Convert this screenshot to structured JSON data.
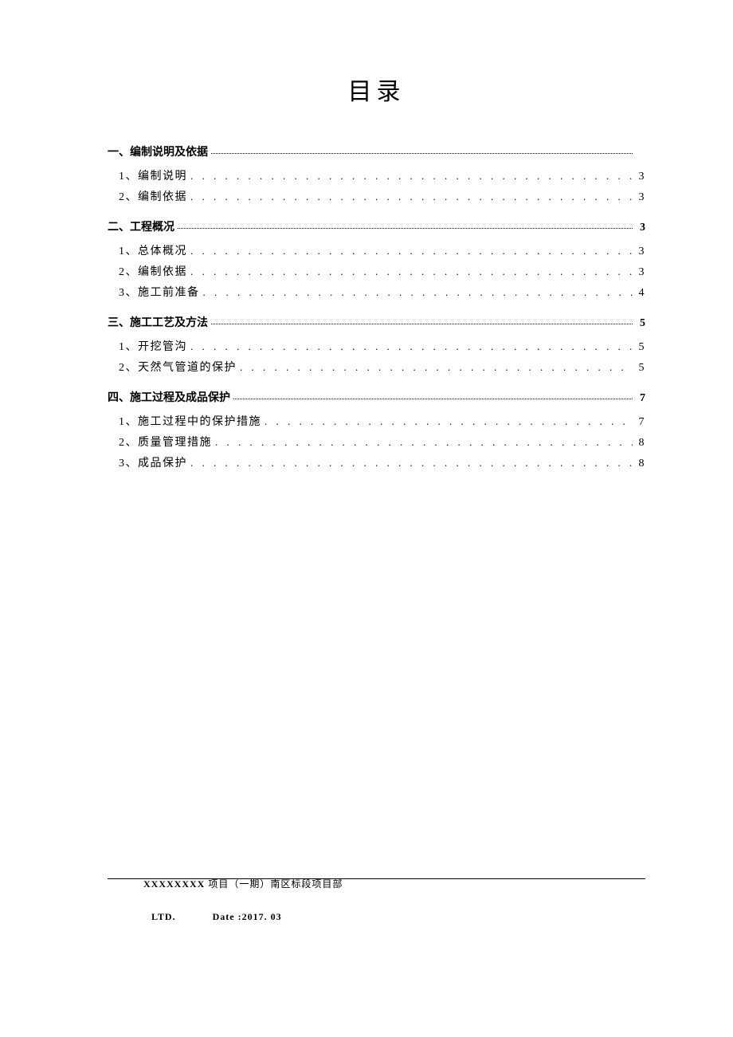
{
  "title": "目录",
  "sections": [
    {
      "num": "一、",
      "label": "编制说明及依据",
      "page": "",
      "subs": [
        {
          "num": "1、",
          "label": "编制说明",
          "page": "3"
        },
        {
          "num": "2、",
          "label": "编制依据",
          "page": "3"
        }
      ]
    },
    {
      "num": "二、",
      "label": "工程概况",
      "page": "3",
      "subs": [
        {
          "num": "1、",
          "label": "总体概况",
          "page": "3"
        },
        {
          "num": "2、",
          "label": "编制依据",
          "page": "3"
        },
        {
          "num": "3、",
          "label": "施工前准备",
          "page": "4"
        }
      ]
    },
    {
      "num": "三、",
      "label": "施工工艺及方法",
      "page": "5",
      "subs": [
        {
          "num": "1、",
          "label": "开挖管沟",
          "page": "5"
        },
        {
          "num": "2、",
          "label": "天然气管道的保护",
          "page": "5"
        }
      ]
    },
    {
      "num": "四、",
      "label": "施工过程及成品保护",
      "page": "7",
      "subs": [
        {
          "num": "1、",
          "label": "施工过程中的保护措施",
          "page": "7"
        },
        {
          "num": "2、",
          "label": "质量管理措施",
          "page": "8"
        },
        {
          "num": "3、",
          "label": "成品保护",
          "page": "8"
        }
      ]
    }
  ],
  "footer": {
    "project_prefix": "XXXXXXXX",
    "project_suffix": " 项目（一期）南区标段项目部",
    "ltd": "LTD.",
    "date": "Date :2017. 03"
  }
}
